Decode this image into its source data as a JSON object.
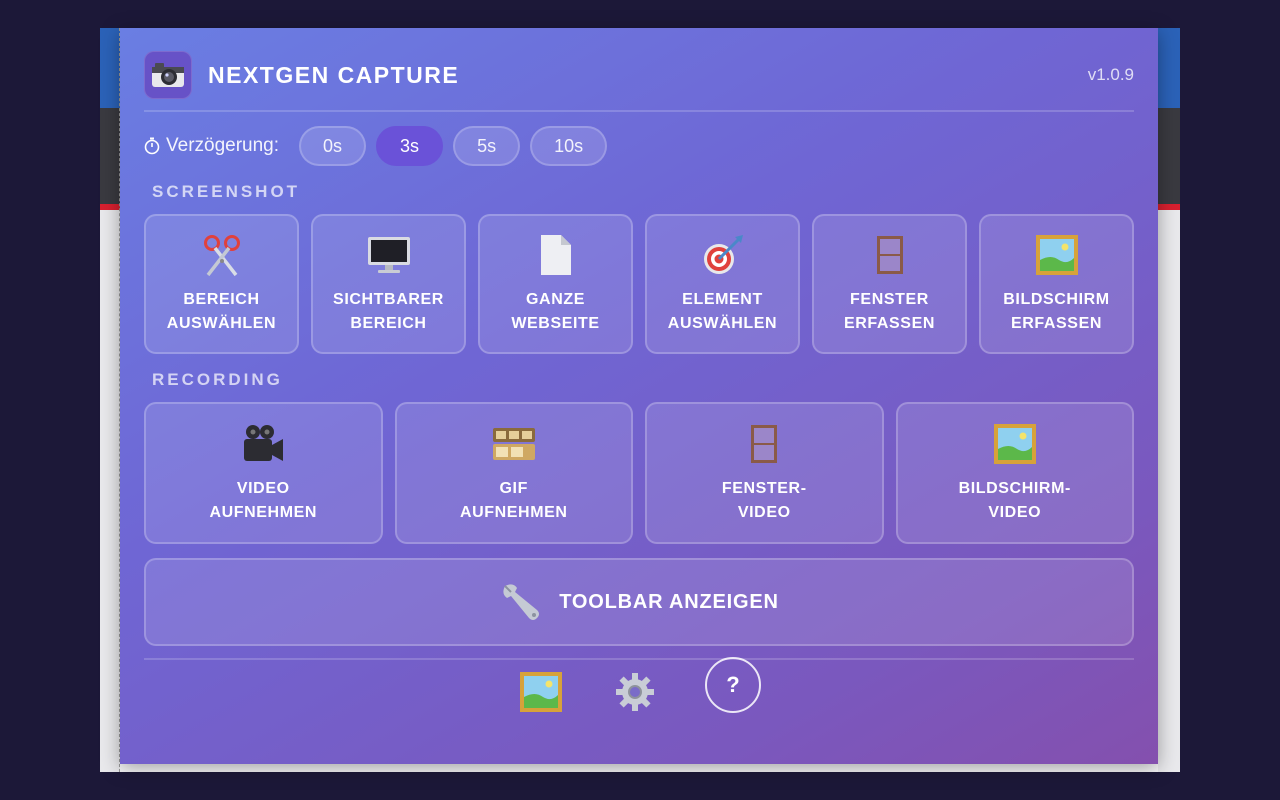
{
  "header": {
    "title": "NEXTGEN CAPTURE",
    "version": "v1.0.9",
    "icon": "camera-icon"
  },
  "delay": {
    "label": "Verzögerung:",
    "icon": "stopwatch-icon",
    "options": [
      "0s",
      "3s",
      "5s",
      "10s"
    ],
    "selected": "3s"
  },
  "screenshot": {
    "section_label": "SCREENSHOT",
    "items": [
      {
        "label": "BEREICH\nAUSWÄHLEN",
        "icon": "scissors-icon"
      },
      {
        "label": "SICHTBARER\nBEREICH",
        "icon": "monitor-icon"
      },
      {
        "label": "GANZE\nWEBSEITE",
        "icon": "page-icon"
      },
      {
        "label": "ELEMENT\nAUSWÄHLEN",
        "icon": "target-icon"
      },
      {
        "label": "FENSTER\nERFASSEN",
        "icon": "window-icon"
      },
      {
        "label": "BILDSCHIRM\nERFASSEN",
        "icon": "framed-picture-icon"
      }
    ]
  },
  "recording": {
    "section_label": "RECORDING",
    "items": [
      {
        "label": "VIDEO\nAUFNEHMEN",
        "icon": "video-camera-icon"
      },
      {
        "label": "GIF\nAUFNEHMEN",
        "icon": "film-frames-icon"
      },
      {
        "label": "FENSTER-\nVIDEO",
        "icon": "window-icon"
      },
      {
        "label": "BILDSCHIRM-\nVIDEO",
        "icon": "framed-picture-icon"
      }
    ]
  },
  "toolbar": {
    "label": "TOOLBAR ANZEIGEN",
    "icon": "wrench-icon"
  },
  "footer": {
    "gallery_icon": "framed-picture-icon",
    "settings_icon": "gear-icon",
    "help_label": "?"
  },
  "colors": {
    "accent": "#6a52d8",
    "gradient_start": "#6a7ee3",
    "gradient_end": "#8450ae"
  }
}
